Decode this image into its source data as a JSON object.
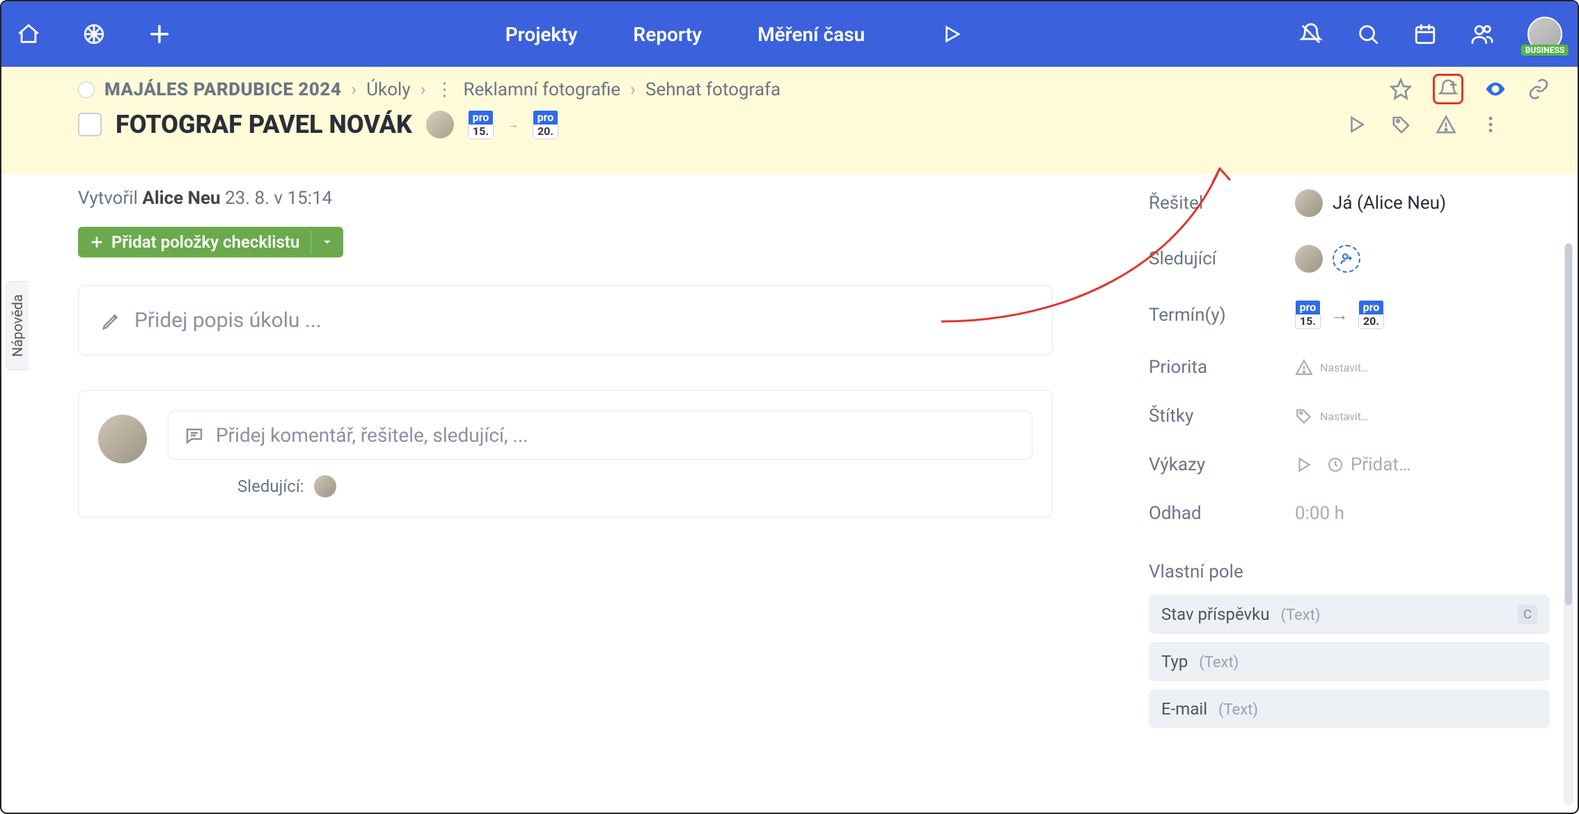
{
  "nav": {
    "links": {
      "projects": "Projekty",
      "reports": "Reporty",
      "timeTracking": "Měření času"
    },
    "businessBadge": "BUSINESS"
  },
  "breadcrumbs": {
    "project": "MAJÁLES PARDUBICE 2024",
    "level1": "Úkoly",
    "level2": "Reklamní fotografie",
    "level3": "Sehnat fotografa"
  },
  "task": {
    "title": "FOTOGRAF PAVEL NOVÁK",
    "dateStartTop": "pro",
    "dateStartBottom": "15.",
    "dateEndTop": "pro",
    "dateEndBottom": "20."
  },
  "created": {
    "prefix": "Vytvořil",
    "author": "Alice Neu",
    "timestamp": "23. 8. v 15:14"
  },
  "checklistBtn": "Přidat položky checklistu",
  "description": {
    "placeholder": "Přidej popis úkolu ..."
  },
  "comment": {
    "placeholder": "Přidej komentář, řešitele, sledující, ..."
  },
  "followersLabel": "Sledující:",
  "side": {
    "assignee": {
      "label": "Řešitel",
      "value": "Já (Alice Neu)"
    },
    "followers": {
      "label": "Sledující"
    },
    "deadline": {
      "label": "Termín(y)",
      "startTop": "pro",
      "startBottom": "15.",
      "endTop": "pro",
      "endBottom": "20."
    },
    "priority": {
      "label": "Priorita",
      "placeholder": "Nastavit…"
    },
    "tags": {
      "label": "Štítky",
      "placeholder": "Nastavit…"
    },
    "worklogs": {
      "label": "Výkazy",
      "placeholder": "Přidat…"
    },
    "estimate": {
      "label": "Odhad",
      "value": "0:00 h"
    },
    "customFieldsTitle": "Vlastní pole",
    "customFields": [
      {
        "label": "Stav příspěvku",
        "type": "(Text)",
        "badge": "C"
      },
      {
        "label": "Typ",
        "type": "(Text)"
      },
      {
        "label": "E-mail",
        "type": "(Text)"
      }
    ]
  },
  "helpTab": "Nápověda"
}
